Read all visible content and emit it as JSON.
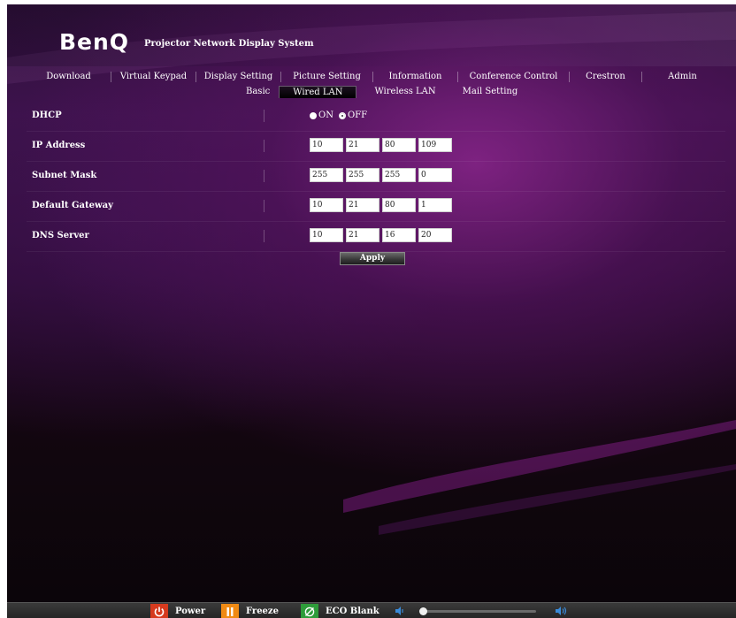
{
  "header": {
    "logo": "BenQ",
    "system_title": "Projector Network Display System"
  },
  "main_nav": [
    {
      "label": "Download"
    },
    {
      "label": "Virtual Keypad"
    },
    {
      "label": "Display Setting"
    },
    {
      "label": "Picture Setting"
    },
    {
      "label": "Information"
    },
    {
      "label": "Conference Control"
    },
    {
      "label": "Crestron"
    },
    {
      "label": "Admin"
    }
  ],
  "sub_nav": [
    {
      "label": "Basic",
      "active": false
    },
    {
      "label": "Wired LAN",
      "active": true
    },
    {
      "label": "Wireless LAN",
      "active": false
    },
    {
      "label": "Mail Setting",
      "active": false
    }
  ],
  "form": {
    "dhcp": {
      "label": "DHCP",
      "on_label": "ON",
      "off_label": "OFF",
      "selected": "OFF"
    },
    "ip_address": {
      "label": "IP Address",
      "octets": [
        "10",
        "21",
        "80",
        "109"
      ]
    },
    "subnet_mask": {
      "label": "Subnet Mask",
      "octets": [
        "255",
        "255",
        "255",
        "0"
      ]
    },
    "default_gateway": {
      "label": "Default Gateway",
      "octets": [
        "10",
        "21",
        "80",
        "1"
      ]
    },
    "dns_server": {
      "label": "DNS Server",
      "octets": [
        "10",
        "21",
        "16",
        "20"
      ]
    },
    "apply_label": "Apply"
  },
  "bottom_bar": {
    "power_label": "Power",
    "freeze_label": "Freeze",
    "eco_label": "ECO Blank",
    "volume_level": 0,
    "colors": {
      "power": "#d63a1e",
      "freeze": "#f08a14",
      "eco": "#2e9c3a",
      "volume_icon": "#3a8ad8"
    },
    "icons": [
      "power-icon",
      "pause-icon",
      "eco-blank-icon",
      "volume-down-icon",
      "volume-up-icon"
    ]
  }
}
